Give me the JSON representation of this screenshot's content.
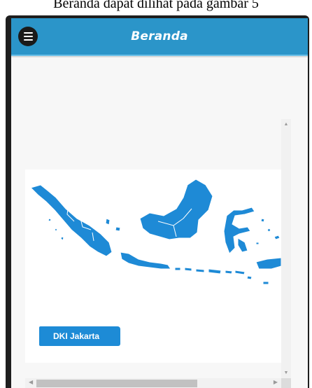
{
  "caption": {
    "text": "Beranda dapat dilihat pada gambar 5"
  },
  "app_bar": {
    "title": "Beranda",
    "menu_icon": "hamburger-menu-icon"
  },
  "map": {
    "hover_label": "DKI Jakarta",
    "fill_color": "#1e8ad6"
  },
  "scrollbars": {
    "vertical": true,
    "horizontal": true
  }
}
